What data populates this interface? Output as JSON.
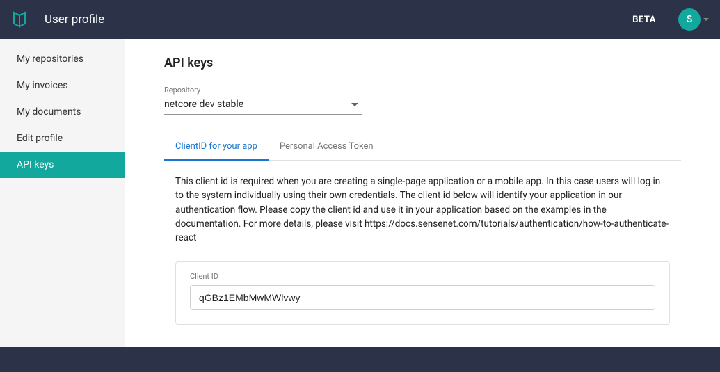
{
  "header": {
    "title": "User profile",
    "beta_label": "BETA",
    "avatar_initial": "S"
  },
  "sidebar": {
    "items": [
      {
        "label": "My repositories"
      },
      {
        "label": "My invoices"
      },
      {
        "label": "My documents"
      },
      {
        "label": "Edit profile"
      },
      {
        "label": "API keys"
      }
    ]
  },
  "main": {
    "title": "API keys",
    "repo_label": "Repository",
    "repo_value": "netcore dev stable",
    "tabs": [
      {
        "label": "ClientID for your app"
      },
      {
        "label": "Personal Access Token"
      }
    ],
    "description": "This client id is required when you are creating a single-page application or a mobile app. In this case users will log in to the system individually using their own credentials. The client id below will identify your application in our authentication flow. Please copy the client id and use it in your application based on the examples in the documentation. For more details, please visit https://docs.sensenet.com/tutorials/authentication/how-to-authenticate-react",
    "client_id_label": "Client ID",
    "client_id_value": "qGBz1EMbMwMWlvwy"
  }
}
